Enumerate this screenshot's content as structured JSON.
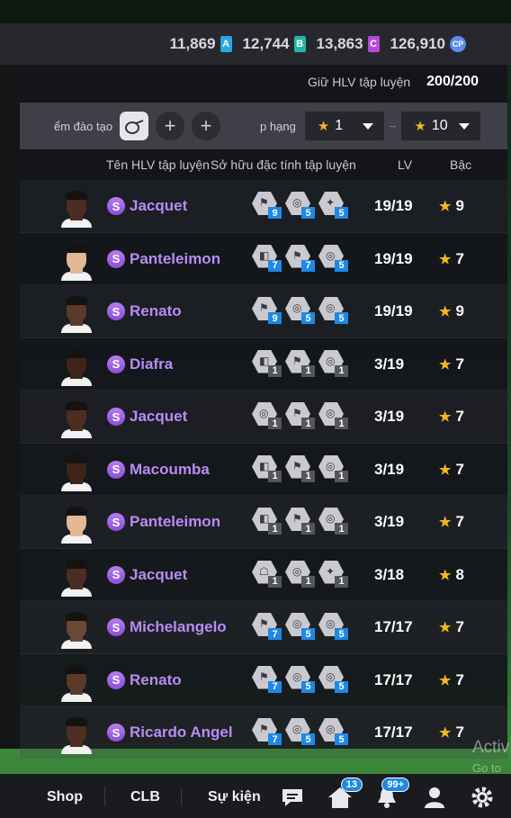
{
  "currency": [
    {
      "value": "11,869",
      "icon": "A",
      "color": "#2aa7e0"
    },
    {
      "value": "12,744",
      "icon": "B",
      "color": "#22b7a8"
    },
    {
      "value": "13,863",
      "icon": "C",
      "color": "#b34ad6"
    },
    {
      "value": "126,910",
      "icon": "CP",
      "color": "#5b8def"
    }
  ],
  "keep": {
    "label": "Giữ HLV tập luyện",
    "value": "200/200"
  },
  "filter": {
    "slot_label": "ểm đào tạo",
    "rank_label": "p hạng",
    "rank_min": "1",
    "rank_sep": "~",
    "rank_max": "10"
  },
  "headers": {
    "name": "Tên HLV tập luyện",
    "traits": "Sở hữu đặc tính tập luyện",
    "lv": "LV",
    "rank": "Bậc"
  },
  "rows": [
    {
      "name": "Jacquet",
      "lv": "19/19",
      "rank": "9",
      "skin": "#4a2e22",
      "traits": [
        {
          "lvl": "9",
          "c": "blue",
          "g": "⚑"
        },
        {
          "lvl": "5",
          "c": "blue",
          "g": "◎"
        },
        {
          "lvl": "5",
          "c": "blue",
          "g": "✦"
        }
      ]
    },
    {
      "name": "Panteleimon",
      "lv": "19/19",
      "rank": "7",
      "skin": "#e2b895",
      "traits": [
        {
          "lvl": "7",
          "c": "blue",
          "g": "◧"
        },
        {
          "lvl": "7",
          "c": "blue",
          "g": "⚑"
        },
        {
          "lvl": "5",
          "c": "blue",
          "g": "◎"
        }
      ]
    },
    {
      "name": "Renato",
      "lv": "19/19",
      "rank": "9",
      "skin": "#5a3a2a",
      "traits": [
        {
          "lvl": "9",
          "c": "blue",
          "g": "⚑"
        },
        {
          "lvl": "5",
          "c": "blue",
          "g": "◎"
        },
        {
          "lvl": "5",
          "c": "blue",
          "g": "◎"
        }
      ]
    },
    {
      "name": "Diafra",
      "lv": "3/19",
      "rank": "7",
      "skin": "#3e2418",
      "traits": [
        {
          "lvl": "1",
          "c": "gray",
          "g": "◧"
        },
        {
          "lvl": "1",
          "c": "gray",
          "g": "⚑"
        },
        {
          "lvl": "1",
          "c": "gray",
          "g": "◎"
        }
      ]
    },
    {
      "name": "Jacquet",
      "lv": "3/19",
      "rank": "7",
      "skin": "#4a2e22",
      "traits": [
        {
          "lvl": "1",
          "c": "gray",
          "g": "◎"
        },
        {
          "lvl": "1",
          "c": "gray",
          "g": "⚑"
        },
        {
          "lvl": "1",
          "c": "gray",
          "g": "◎"
        }
      ]
    },
    {
      "name": "Macoumba",
      "lv": "3/19",
      "rank": "7",
      "skin": "#3e2418",
      "traits": [
        {
          "lvl": "1",
          "c": "gray",
          "g": "◧"
        },
        {
          "lvl": "1",
          "c": "gray",
          "g": "⚑"
        },
        {
          "lvl": "1",
          "c": "gray",
          "g": "◎"
        }
      ]
    },
    {
      "name": "Panteleimon",
      "lv": "3/19",
      "rank": "7",
      "skin": "#e2b895",
      "traits": [
        {
          "lvl": "1",
          "c": "gray",
          "g": "◧"
        },
        {
          "lvl": "1",
          "c": "gray",
          "g": "⚑"
        },
        {
          "lvl": "1",
          "c": "gray",
          "g": "◎"
        }
      ]
    },
    {
      "name": "Jacquet",
      "lv": "3/18",
      "rank": "8",
      "skin": "#4a2e22",
      "traits": [
        {
          "lvl": "1",
          "c": "gray",
          "g": "☖"
        },
        {
          "lvl": "1",
          "c": "gray",
          "g": "◎"
        },
        {
          "lvl": "1",
          "c": "gray",
          "g": "✦"
        }
      ]
    },
    {
      "name": "Michelangelo",
      "lv": "17/17",
      "rank": "7",
      "skin": "#6a4a36",
      "traits": [
        {
          "lvl": "7",
          "c": "blue",
          "g": "⚑"
        },
        {
          "lvl": "5",
          "c": "blue",
          "g": "◎"
        },
        {
          "lvl": "5",
          "c": "blue",
          "g": "◎"
        }
      ]
    },
    {
      "name": "Renato",
      "lv": "17/17",
      "rank": "7",
      "skin": "#5a3a2a",
      "traits": [
        {
          "lvl": "7",
          "c": "blue",
          "g": "⚑"
        },
        {
          "lvl": "5",
          "c": "blue",
          "g": "◎"
        },
        {
          "lvl": "5",
          "c": "blue",
          "g": "◎"
        }
      ]
    },
    {
      "name": "Ricardo Angel",
      "lv": "17/17",
      "rank": "7",
      "skin": "#4e2e20",
      "traits": [
        {
          "lvl": "7",
          "c": "blue",
          "g": "⚑"
        },
        {
          "lvl": "5",
          "c": "blue",
          "g": "◎"
        },
        {
          "lvl": "5",
          "c": "blue",
          "g": "◎"
        }
      ]
    }
  ],
  "watermark": {
    "line1": "Activ",
    "line2": "Go to S"
  },
  "nav": {
    "shop": "Shop",
    "club": "CLB",
    "events": "Sự kiện",
    "home_badge": "13",
    "notif_badge": "99+"
  }
}
